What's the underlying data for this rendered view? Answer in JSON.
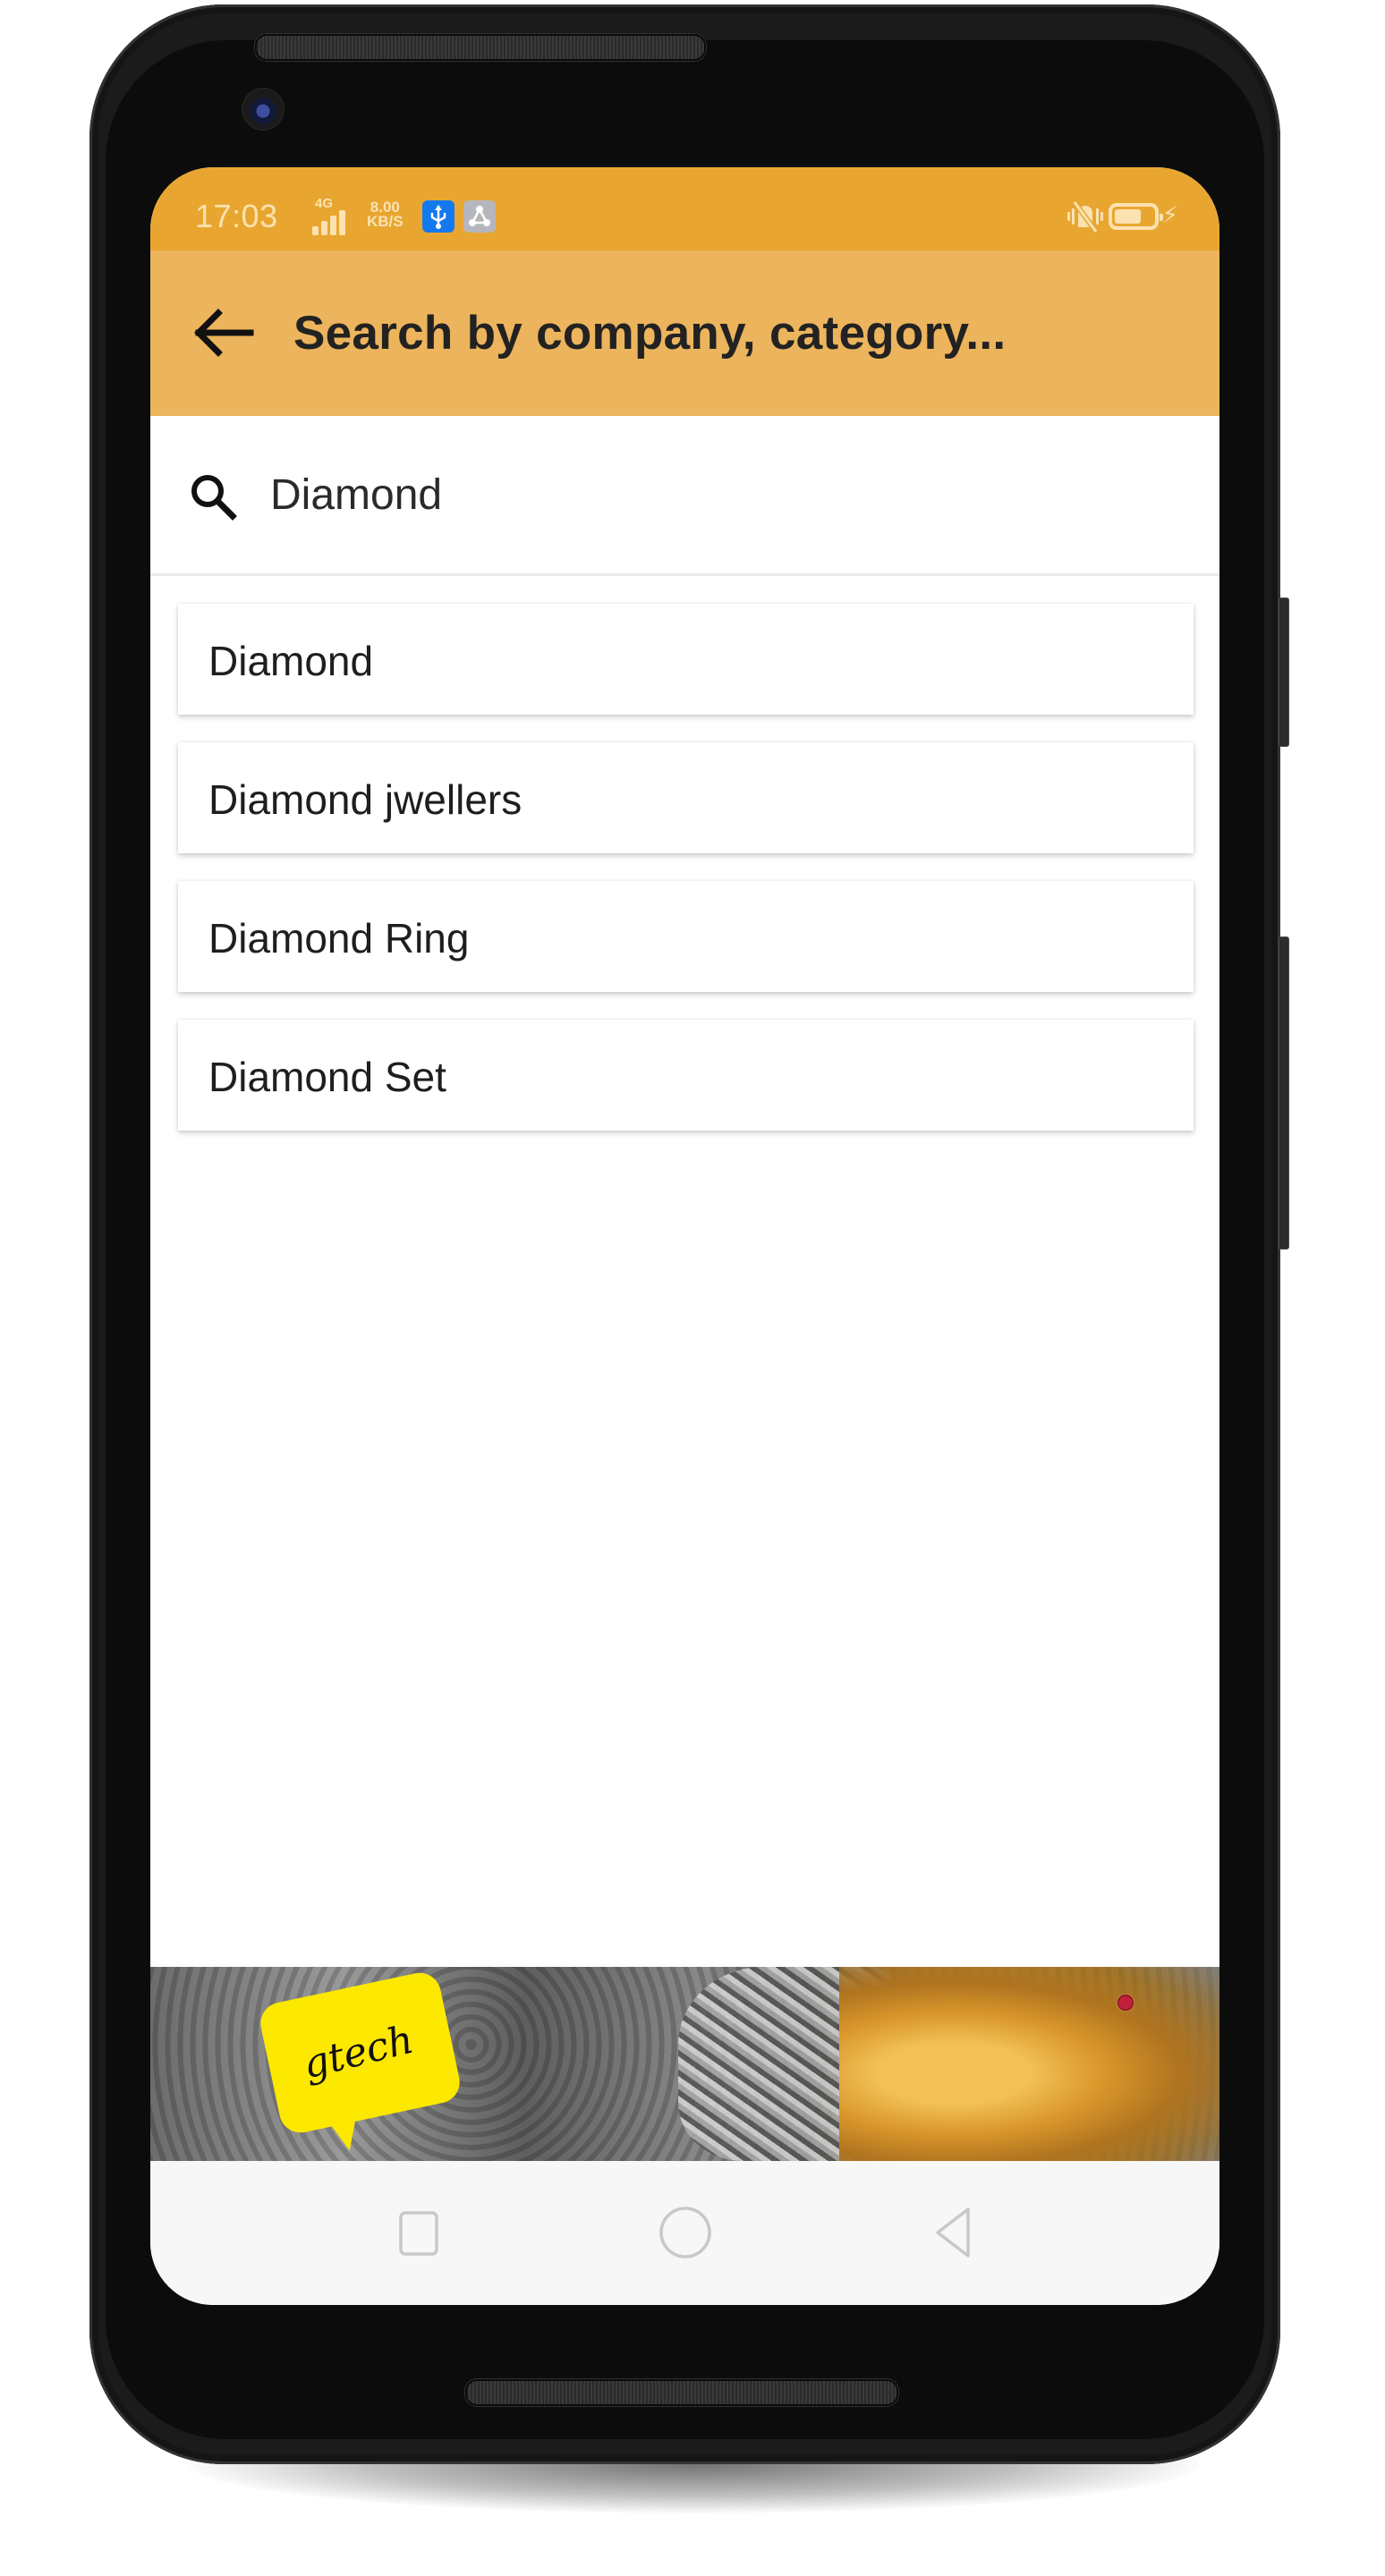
{
  "status_bar": {
    "time": "17:03",
    "network_type": "4G",
    "signal_bars": 4,
    "speed_value": "8.00",
    "speed_unit": "KB/S",
    "icons": [
      "usb-debugging-icon",
      "share-hotspot-icon",
      "vibrate-off-icon",
      "battery-icon",
      "charging-bolt-icon"
    ],
    "battery_level": 0.7,
    "colors": {
      "background": "#e8a631",
      "foreground": "#fbe2b0",
      "usb_badge": "#1479ef",
      "share_badge": "#b6b6bd"
    }
  },
  "app_bar": {
    "back_icon": "arrow-left-icon",
    "title": "Search by company, category...",
    "background": "#ecb45c"
  },
  "search": {
    "icon": "search-icon",
    "value": "Diamond",
    "placeholder": ""
  },
  "results": [
    {
      "label": "Diamond"
    },
    {
      "label": "Diamond jwellers"
    },
    {
      "label": "Diamond Ring"
    },
    {
      "label": "Diamond Set"
    }
  ],
  "banner": {
    "logo_text": "gtech",
    "logo_color": "#fde800",
    "alt": "gold and silver jewellery advertisement"
  },
  "nav_bar": {
    "buttons": [
      {
        "name": "recents",
        "icon": "square-icon"
      },
      {
        "name": "home",
        "icon": "circle-icon"
      },
      {
        "name": "back",
        "icon": "triangle-back-icon"
      }
    ]
  }
}
